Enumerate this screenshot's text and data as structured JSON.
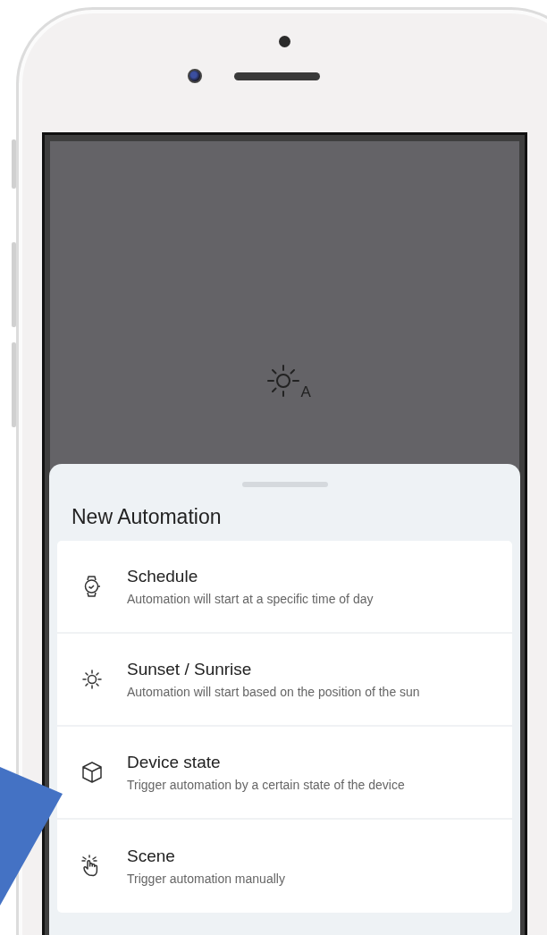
{
  "screen": {
    "empty_state": {
      "icon_letter": "A"
    }
  },
  "sheet": {
    "title": "New Automation",
    "options": [
      {
        "kind": "schedule",
        "title": "Schedule",
        "description": "Automation will start at a specific time of day"
      },
      {
        "kind": "sun",
        "title": "Sunset / Sunrise",
        "description": "Automation will start based on the position of the sun"
      },
      {
        "kind": "device",
        "title": "Device state",
        "description": "Trigger automation by a certain state of the device"
      },
      {
        "kind": "scene",
        "title": "Scene",
        "description": "Trigger automation manually"
      }
    ]
  }
}
